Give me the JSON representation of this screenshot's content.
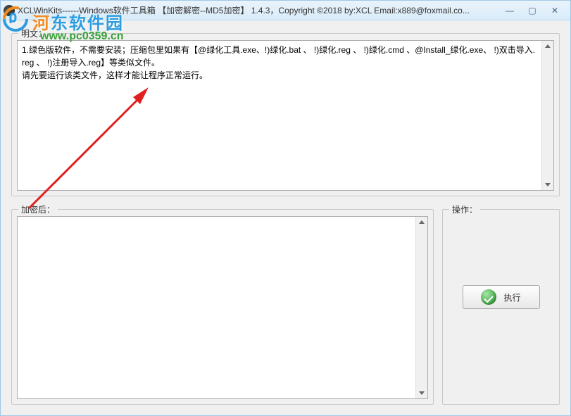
{
  "window": {
    "title": "XCLWinKits------Windows软件工具箱  【加密解密--MD5加密】  1.4.3，Copyright ©2018 by:XCL Email:x889@foxmail.co..."
  },
  "groups": {
    "plaintext_label": "明文：",
    "encrypted_label": "加密后：",
    "action_label": "操作："
  },
  "plaintext": {
    "line1": "1.绿色版软件，不需要安装；压缩包里如果有【@绿化工具.exe、!)绿化.bat 、 !)绿化.reg 、 !)绿化.cmd 、@Install_绿化.exe、 !)双击导入.reg 、 !)注册导入.reg】等类似文件。",
    "line2": "  请先要运行该类文件，这样才能让程序正常运行。"
  },
  "encrypted": {
    "value": ""
  },
  "buttons": {
    "execute": "执行"
  },
  "watermark": {
    "brand_part1": "河",
    "brand_part2": "东软件园",
    "url": "www.pc0359.cn"
  },
  "win_controls": {
    "minimize": "—",
    "maximize": "▢",
    "close": "✕"
  }
}
